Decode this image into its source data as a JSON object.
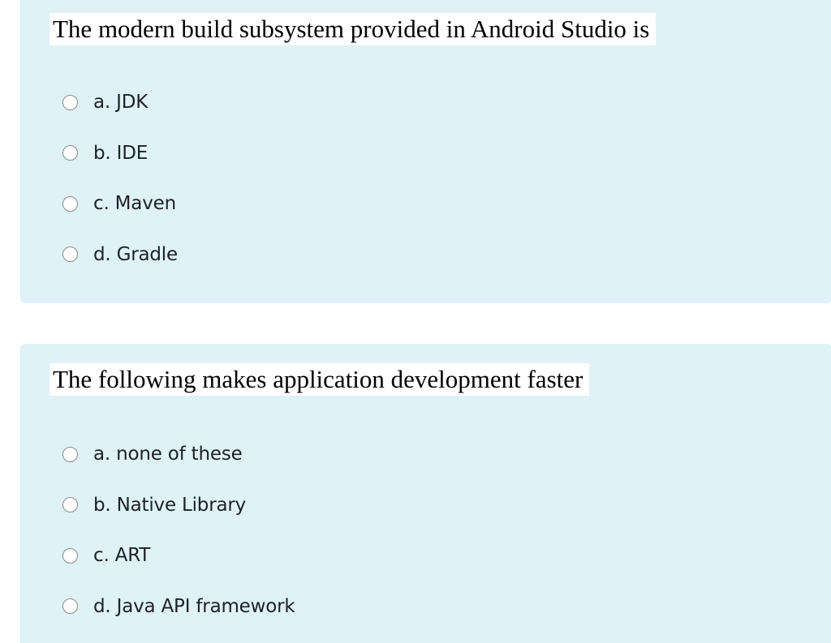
{
  "questions": [
    {
      "text": "The modern build subsystem provided in Android Studio is",
      "options": [
        "a. JDK",
        "b. IDE",
        "c. Maven",
        "d. Gradle"
      ]
    },
    {
      "text": "The following makes application development faster",
      "options": [
        "a. none of these",
        "b. Native Library",
        "c. ART",
        "d. Java API framework"
      ]
    }
  ],
  "colors": {
    "card_background": "#def2f8",
    "question_background": "#ffffff",
    "option_text": "#1d2125"
  }
}
